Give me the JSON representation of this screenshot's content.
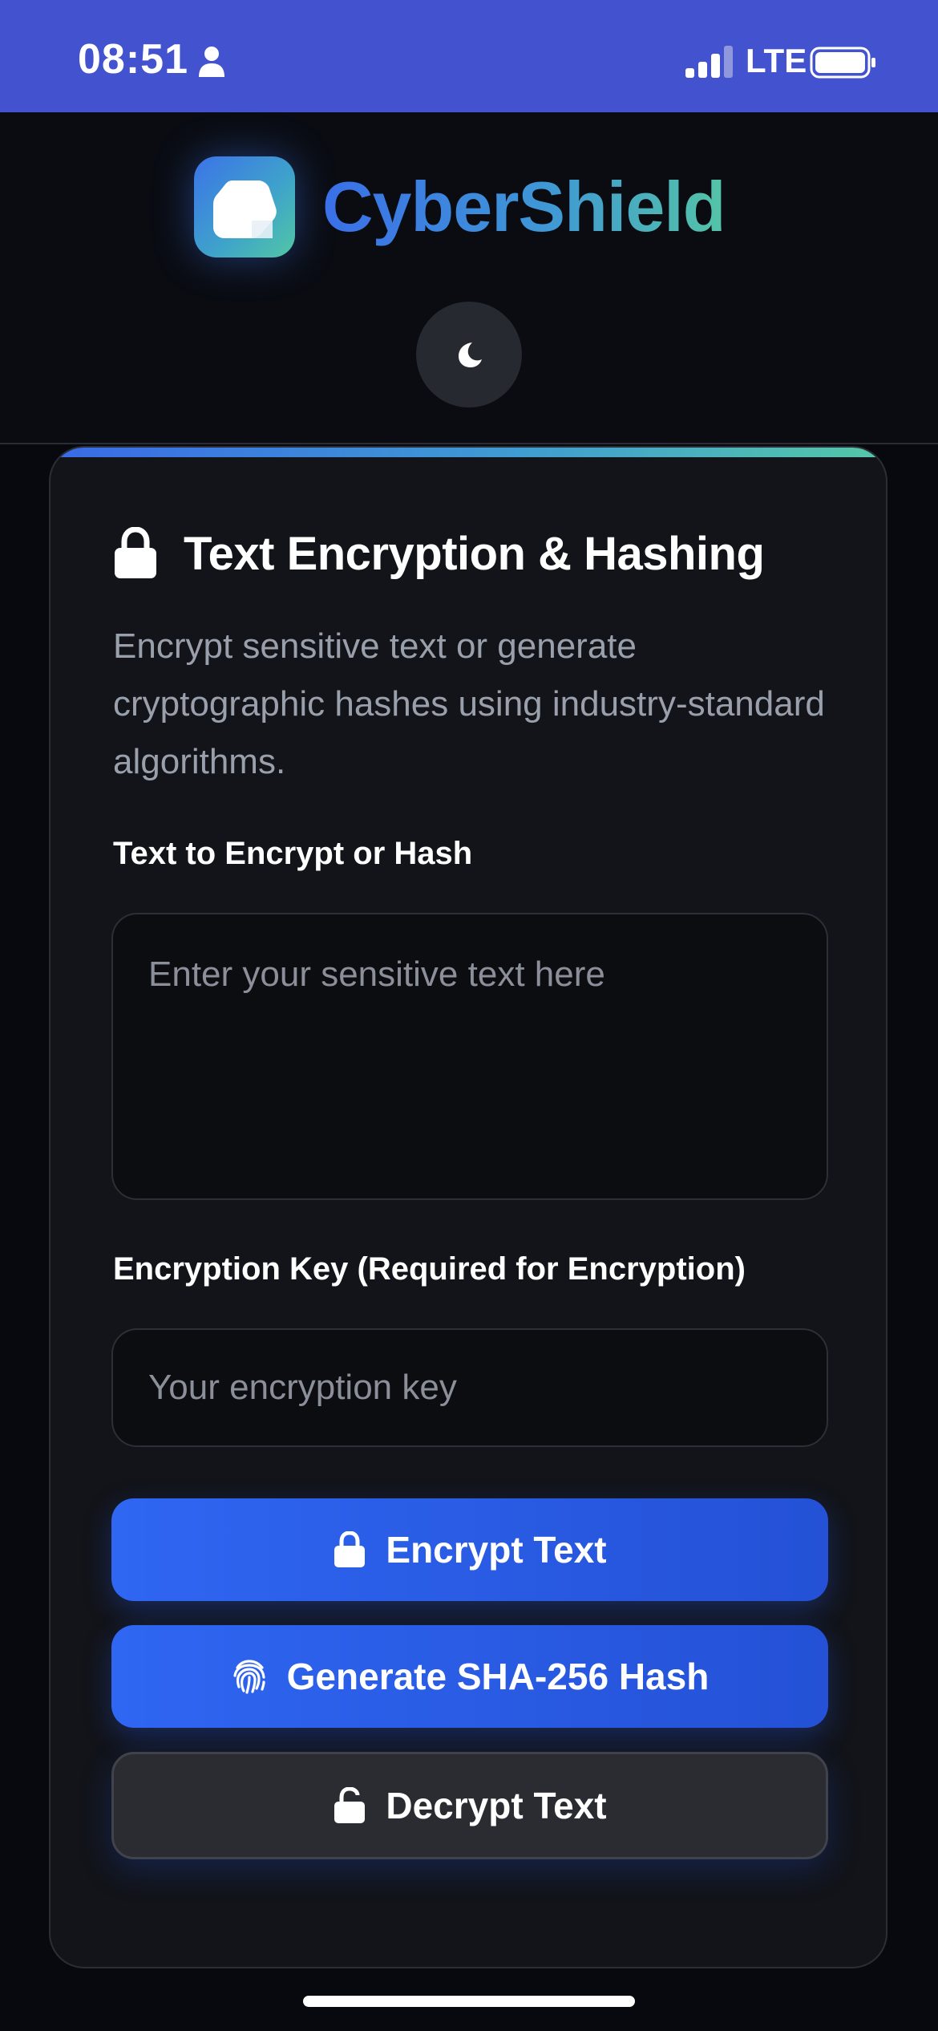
{
  "status_bar": {
    "time": "08:51",
    "network": "LTE",
    "person_icon": "person-icon",
    "signal_icon": "signal-bars-icon",
    "battery_icon": "battery-icon"
  },
  "header": {
    "brand": "CyberShield",
    "logo_icon": "shield-logo-icon",
    "theme_toggle_icon": "moon-icon"
  },
  "card": {
    "title": "Text Encryption & Hashing",
    "title_icon": "lock-icon",
    "description": "Encrypt sensitive text or generate cryptographic hashes using industry-standard algorithms.",
    "text_field": {
      "label": "Text to Encrypt or Hash",
      "value": "",
      "placeholder": "Enter your sensitive text here"
    },
    "key_field": {
      "label": "Encryption Key (Required for Encryption)",
      "value": "",
      "placeholder": "Your encryption key"
    },
    "buttons": {
      "encrypt": {
        "label": "Encrypt Text",
        "icon": "lock-icon"
      },
      "hash": {
        "label": "Generate SHA-256 Hash",
        "icon": "fingerprint-icon"
      },
      "decrypt": {
        "label": "Decrypt Text",
        "icon": "unlock-icon"
      }
    }
  },
  "colors": {
    "status_bar": "#4353cf",
    "background": "#07090f",
    "card": "#121419",
    "primary_button": "#2f66f2",
    "secondary_button": "#2a2c31",
    "gradient_start": "#3a6ae6",
    "gradient_end": "#55c7a8"
  }
}
